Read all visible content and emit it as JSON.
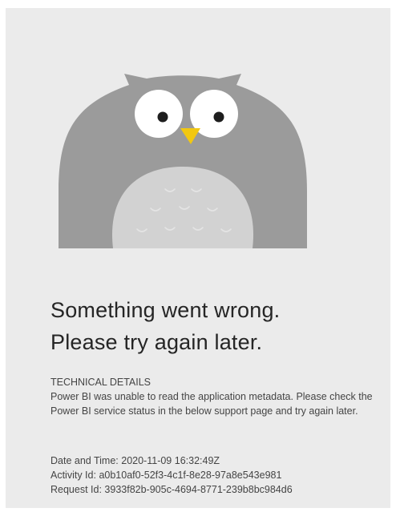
{
  "error": {
    "headline_line1": "Something went wrong.",
    "headline_line2": "Please try again later.",
    "details_label": "TECHNICAL DETAILS",
    "details_text": "Power BI was unable to read the application metadata. Please check the Power BI service status in the below support page and try again later.",
    "date_label": "Date and Time:",
    "date_value": "2020-11-09 16:32:49Z",
    "activity_label": "Activity Id:",
    "activity_value": "a0b10af0-52f3-4c1f-8e28-97a8e543e981",
    "request_label": "Request Id:",
    "request_value": "3933f82b-905c-4694-8771-239b8bc984d6"
  },
  "illustration": {
    "icon": "owl-icon",
    "colors": {
      "body": "#9b9b9b",
      "belly": "#d2d2d2",
      "eye_white": "#ffffff",
      "pupil": "#1e1e1e",
      "beak": "#f2c811",
      "background": "#ebebeb"
    }
  }
}
